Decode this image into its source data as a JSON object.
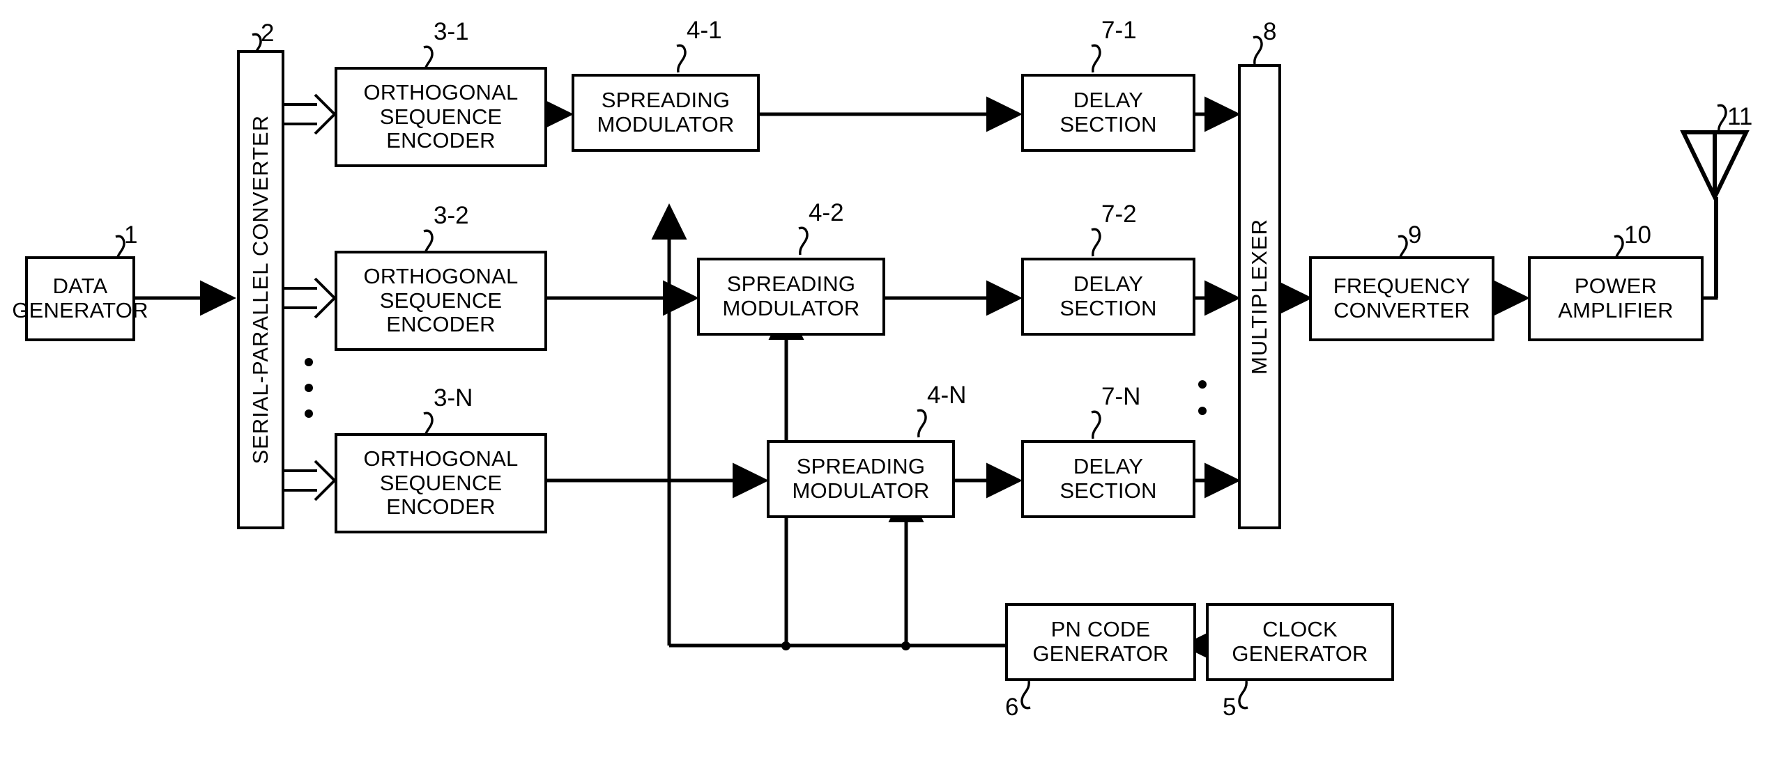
{
  "figure": {
    "kind": "patent-block-diagram",
    "background": "#ffffff",
    "ink": "#000000"
  },
  "blocks": {
    "data_generator": {
      "label": "DATA\nGENERATOR",
      "ref": "1"
    },
    "sp_converter": {
      "label": "SERIAL-PARALLEL CONVERTER",
      "ref": "2"
    },
    "ose_1": {
      "label": "ORTHOGONAL\nSEQUENCE\nENCODER",
      "ref": "3-1"
    },
    "ose_2": {
      "label": "ORTHOGONAL\nSEQUENCE\nENCODER",
      "ref": "3-2"
    },
    "ose_n": {
      "label": "ORTHOGONAL\nSEQUENCE\nENCODER",
      "ref": "3-N"
    },
    "spread_1": {
      "label": "SPREADING\nMODULATOR",
      "ref": "4-1"
    },
    "spread_2": {
      "label": "SPREADING\nMODULATOR",
      "ref": "4-2"
    },
    "spread_n": {
      "label": "SPREADING\nMODULATOR",
      "ref": "4-N"
    },
    "delay_1": {
      "label": "DELAY\nSECTION",
      "ref": "7-1"
    },
    "delay_2": {
      "label": "DELAY\nSECTION",
      "ref": "7-2"
    },
    "delay_n": {
      "label": "DELAY\nSECTION",
      "ref": "7-N"
    },
    "multiplexer": {
      "label": "MULTIPLEXER",
      "ref": "8"
    },
    "freq_converter": {
      "label": "FREQUENCY\nCONVERTER",
      "ref": "9"
    },
    "power_amplifier": {
      "label": "POWER\nAMPLIFIER",
      "ref": "10"
    },
    "antenna": {
      "label": "",
      "ref": "11"
    },
    "pn_code_generator": {
      "label": "PN CODE\nGENERATOR",
      "ref": "6"
    },
    "clock_generator": {
      "label": "CLOCK\nGENERATOR",
      "ref": "5"
    }
  },
  "ellipsis": {
    "sp_outputs": "• • •",
    "mux_inputs": "• •"
  }
}
